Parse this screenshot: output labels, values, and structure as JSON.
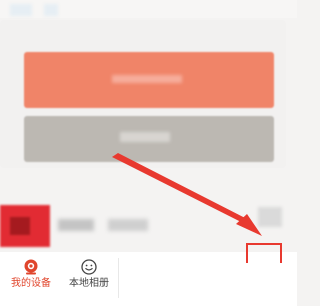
{
  "tabbar": {
    "tabs": [
      {
        "label": "我的设备",
        "icon": "camera-eye-icon",
        "active": true
      },
      {
        "label": "本地相册",
        "icon": "smiley-face-icon",
        "active": false
      }
    ]
  },
  "colors": {
    "accent": "#e0452c",
    "primary_button": "#f08468",
    "secondary_button": "#bcb8b2",
    "annotation": "#e8392f"
  }
}
